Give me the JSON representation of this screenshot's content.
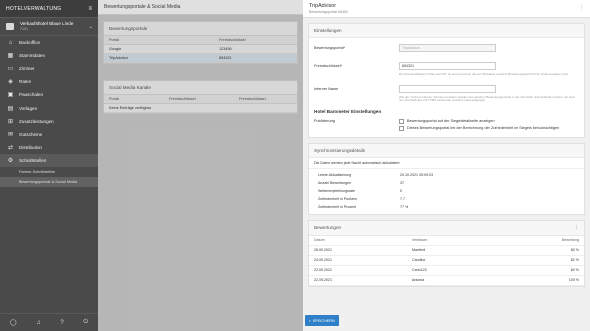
{
  "sidebar": {
    "title": "HOTELVERWALTUNG",
    "hotel_name": "Verkaufshotel Blaue Linde",
    "hotel_sub": "7101",
    "items": [
      {
        "label": "Backoffice",
        "icon": "home-icon",
        "glyph": "⌂"
      },
      {
        "label": "Stammdaten",
        "icon": "grid-icon",
        "glyph": "▦"
      },
      {
        "label": "Zimmer",
        "icon": "bed-icon",
        "glyph": "▭"
      },
      {
        "label": "Raten",
        "icon": "tag-icon",
        "glyph": "◈"
      },
      {
        "label": "Pauschalen",
        "icon": "suitcase-icon",
        "glyph": "▣"
      },
      {
        "label": "Vorlagen",
        "icon": "template-icon",
        "glyph": "▤"
      },
      {
        "label": "Zusatzleistungen",
        "icon": "plus-box-icon",
        "glyph": "⊞"
      },
      {
        "label": "Gutscheine",
        "icon": "gift-icon",
        "glyph": "✉"
      },
      {
        "label": "Distribution",
        "icon": "distribution-icon",
        "glyph": "⇄"
      },
      {
        "label": "Schnittstellen",
        "icon": "plug-icon",
        "glyph": "⚙"
      }
    ],
    "sub_items": [
      "Partner-Schnittstellen",
      "Bewertungsportale & Social Media"
    ]
  },
  "main": {
    "title": "Bewertungsportale & Social Media",
    "portals": {
      "title": "Bewertungsportale",
      "headers": [
        "Portal",
        "Fremdschlüssel"
      ],
      "rows": [
        [
          "Google",
          "123456"
        ],
        [
          "TripAdvisor",
          "654321"
        ]
      ]
    },
    "social": {
      "title": "Social Media Kanäle",
      "headers": [
        "Portal",
        "Fremdschlüssel",
        "Fremdschlüssel"
      ],
      "empty": "Keine Einträge verfügbar"
    }
  },
  "panel": {
    "title": "TripAdvisor",
    "subtitle": "Bewertungsportal #0452",
    "settings_title": "Einstellungen",
    "portal_label": "Bewertungsportal*",
    "portal_value": "TripAdvisor",
    "key_label": "Fremdschlüssel*",
    "key_value": "654321",
    "key_hint": "Der Fremdschlüssel, früher auch ID, ist eine Kennung, die vom Betreiber auf dem Bewertungsportal für Ihr Hotel vergeben wird.",
    "internal_label": "Interner Name",
    "internal_value": "",
    "internal_hint": "Wie der \"Interner Namen\" können meistens Quellen des gleichen Bewertungsportals in der Übersicht unterschieden werden. Er wird nur innerhalb des CST PMS verwendet und dem Gast angezeigt.",
    "barometer_title": "Hotel Barometer Einstellungen",
    "publish_label": "Publizierung",
    "chk1": "Bewertungsportal auf der Siegeldetailseite anzeigen",
    "chk2": "Dieses Bewertungsportal bei der Berechnung der Zufriedenheit im Siegels berücksichtigen",
    "sync_title": "Synchronisierungsdetails",
    "sync_info": "Die Daten werden jede Nacht automatisch aktualisiert.",
    "sync_rows": [
      [
        "Letzte Aktualisierung",
        "20.10.2021 05:09:03"
      ],
      [
        "Anzahl Bewertungen",
        "37"
      ],
      [
        "Weiterempfehlungsrate",
        "0"
      ],
      [
        "Zufriedenheit in Punkten",
        "7,7"
      ],
      [
        "Zufriedenheit in Prozent",
        "77 %"
      ]
    ],
    "reviews_title": "Bewertungen",
    "reviews_headers": [
      "Datum",
      "Verfasser",
      "Bewertung"
    ],
    "reviews": [
      [
        "26.09.2021",
        "Manfred",
        "80 %"
      ],
      [
        "24.09.2021",
        "Caroline",
        "82 %"
      ],
      [
        "22.09.2021",
        "Carlo123",
        "60 %"
      ],
      [
        "22.09.2021",
        "Antonia",
        "100 %"
      ]
    ],
    "save_label": "SPEICHERN"
  }
}
